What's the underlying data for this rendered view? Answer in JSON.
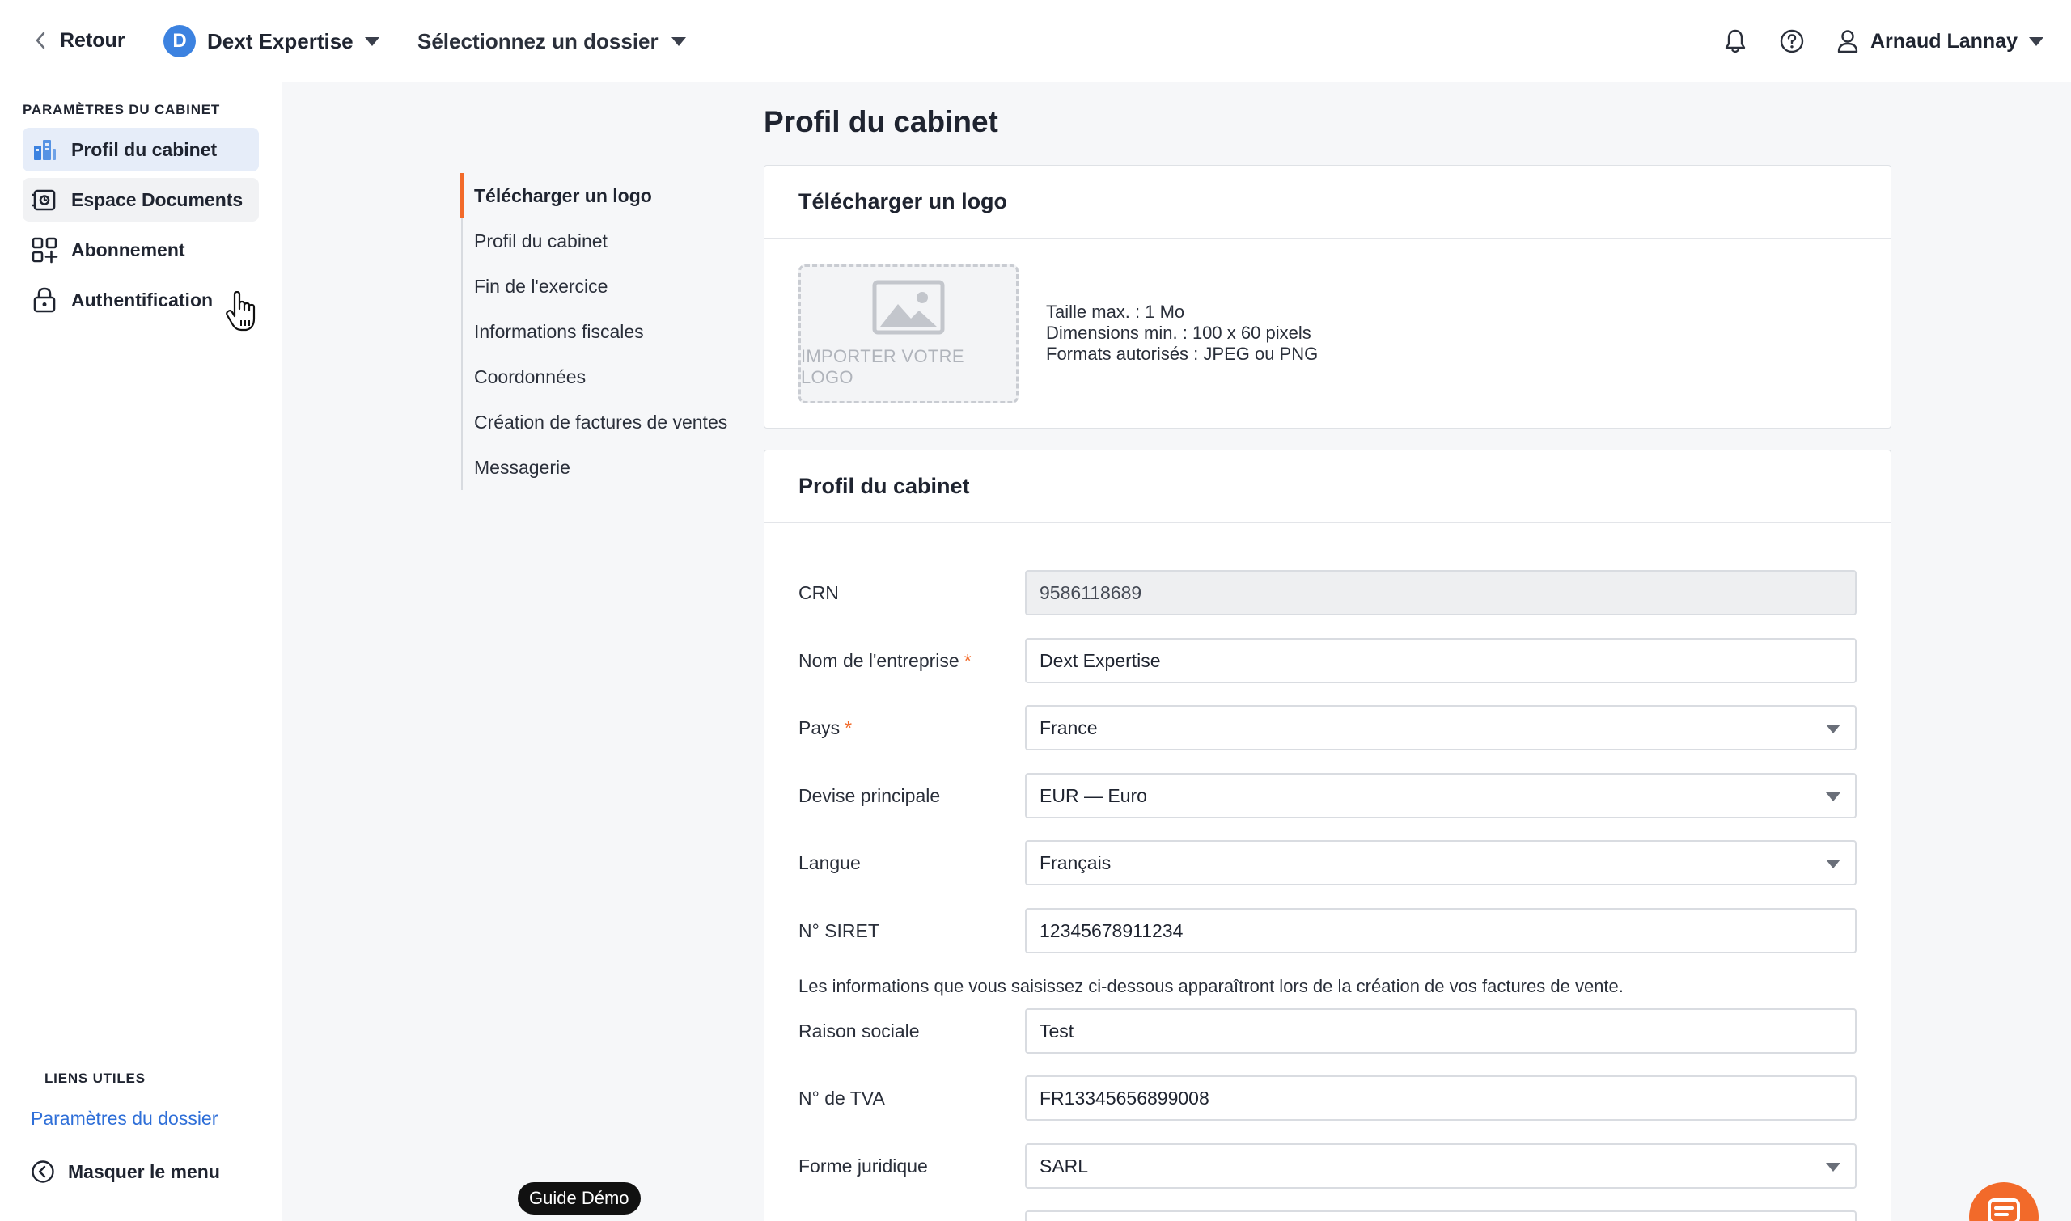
{
  "topbar": {
    "back_label": "Retour",
    "company_initial": "D",
    "company_name": "Dext Expertise",
    "folder_select_label": "Sélectionnez un dossier",
    "user_name": "Arnaud Lannay"
  },
  "sidebar": {
    "section_title": "PARAMÈTRES DU CABINET",
    "items": [
      {
        "label": "Profil du cabinet",
        "icon": "building-chart-icon"
      },
      {
        "label": "Espace Documents",
        "icon": "document-space-icon"
      },
      {
        "label": "Abonnement",
        "icon": "grid-plus-icon"
      },
      {
        "label": "Authentification",
        "icon": "lock-icon"
      }
    ],
    "useful_links_title": "LIENS UTILES",
    "useful_link": "Paramètres du dossier",
    "hide_menu_label": "Masquer le menu"
  },
  "page": {
    "title": "Profil du cabinet"
  },
  "anchor_nav": [
    "Télécharger un logo",
    "Profil du cabinet",
    "Fin de l'exercice",
    "Informations fiscales",
    "Coordonnées",
    "Création de factures de ventes",
    "Messagerie"
  ],
  "logo_card": {
    "title": "Télécharger un logo",
    "drop_label": "IMPORTER VOTRE LOGO",
    "info_lines": [
      "Taille max. : 1 Mo",
      "Dimensions min. : 100 x 60 pixels",
      "Formats autorisés : JPEG ou PNG"
    ]
  },
  "profile_card": {
    "title": "Profil du cabinet",
    "fields": {
      "crn": {
        "label": "CRN",
        "value": "9586118689"
      },
      "company_name": {
        "label": "Nom de l'entreprise",
        "value": "Dext Expertise"
      },
      "country": {
        "label": "Pays",
        "value": "France"
      },
      "currency": {
        "label": "Devise principale",
        "value": "EUR — Euro"
      },
      "language": {
        "label": "Langue",
        "value": "Français"
      },
      "siret": {
        "label": "N° SIRET",
        "value": "12345678911234"
      },
      "legal_name": {
        "label": "Raison sociale",
        "value": "Test"
      },
      "vat": {
        "label": "N° de TVA",
        "value": "FR13345656899008"
      },
      "legal_form": {
        "label": "Forme juridique",
        "value": "SARL"
      }
    },
    "required_mark": "*",
    "info_text": "Les informations que vous saisissez ci-dessous apparaîtront lors de la création de vos factures de vente."
  },
  "guide_demo_label": "Guide Démo",
  "colors": {
    "accent": "#f26a2a",
    "avatar": "#3c82e0",
    "link": "#2f6fd8",
    "active_nav_bg": "#e6edf9"
  }
}
